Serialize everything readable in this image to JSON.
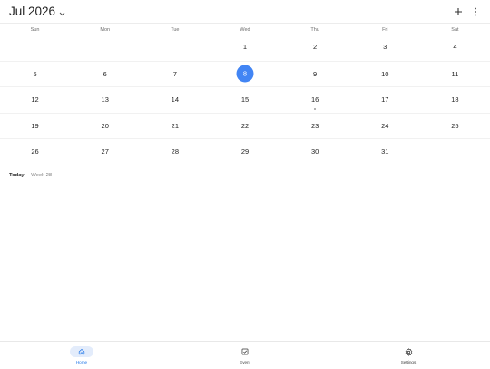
{
  "header": {
    "month_title": "Jul 2026"
  },
  "weekdays": [
    "Sun",
    "Mon",
    "Tue",
    "Wed",
    "Thu",
    "Fri",
    "Sat"
  ],
  "calendar": {
    "weeks": [
      [
        "",
        "",
        "",
        "1",
        "2",
        "3",
        "4"
      ],
      [
        "5",
        "6",
        "7",
        "8",
        "9",
        "10",
        "11"
      ],
      [
        "12",
        "13",
        "14",
        "15",
        "16",
        "17",
        "18"
      ],
      [
        "19",
        "20",
        "21",
        "22",
        "23",
        "24",
        "25"
      ],
      [
        "26",
        "27",
        "28",
        "29",
        "30",
        "31",
        ""
      ]
    ],
    "selected_day": "8",
    "event_days": [
      "16"
    ]
  },
  "summary": {
    "today_label": "Today",
    "week_label": "Week 28"
  },
  "nav": {
    "items": [
      {
        "label": "Home",
        "icon": "home-icon"
      },
      {
        "label": "Event",
        "icon": "event-checkbox-icon"
      },
      {
        "label": "Settings",
        "icon": "gear-icon"
      }
    ],
    "active": "Home"
  },
  "colors": {
    "accent": "#4285f4",
    "nav_active_bg": "#e3ecfb",
    "nav_active_text": "#1a73e8"
  }
}
